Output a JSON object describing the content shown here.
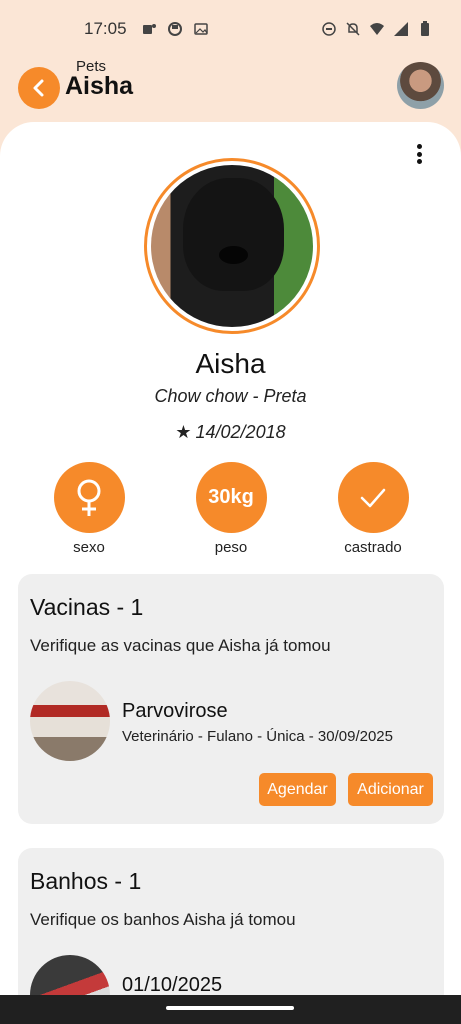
{
  "status": {
    "time": "17:05"
  },
  "header": {
    "subtitle": "Pets",
    "title": "Aisha"
  },
  "colors": {
    "accent": "#f68a2a",
    "header_bg": "#fbe6d6",
    "card_bg": "#efefef"
  },
  "pet": {
    "name": "Aisha",
    "breed": "Chow chow - Preta",
    "birth_date": "14/02/2018"
  },
  "stats": [
    {
      "icon": "female-icon",
      "value": "",
      "label": "sexo"
    },
    {
      "icon": "",
      "value": "30kg",
      "label": "peso"
    },
    {
      "icon": "check-icon",
      "value": "",
      "label": "castrado"
    }
  ],
  "vaccines": {
    "title": "Vacinas - 1",
    "description": "Verifique as vacinas que Aisha já tomou",
    "item": {
      "name": "Parvovirose",
      "details": "Veterinário - Fulano - Única - 30/09/2025"
    },
    "schedule_label": "Agendar",
    "add_label": "Adicionar"
  },
  "baths": {
    "title": "Banhos - 1",
    "description": "Verifique os banhos Aisha já tomou",
    "item": {
      "date": "01/10/2025"
    }
  }
}
